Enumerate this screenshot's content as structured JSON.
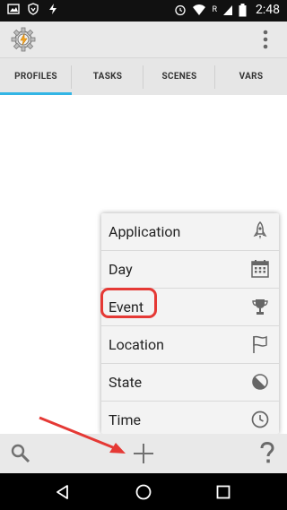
{
  "status_bar": {
    "time": "2:48",
    "network_label": "R",
    "icons": [
      "image-icon",
      "shield-icon",
      "flash-icon",
      "alarm-icon",
      "wifi-icon",
      "signal-icon",
      "battery-icon"
    ]
  },
  "app_bar": {
    "icon": "tasker-gear-icon",
    "overflow_icon": "overflow-menu-icon"
  },
  "tabs": [
    {
      "label": "PROFILES",
      "active": true
    },
    {
      "label": "TASKS",
      "active": false
    },
    {
      "label": "SCENES",
      "active": false
    },
    {
      "label": "VARS",
      "active": false
    }
  ],
  "menu": {
    "items": [
      {
        "label": "Application",
        "icon": "rocket-icon"
      },
      {
        "label": "Day",
        "icon": "calendar-icon"
      },
      {
        "label": "Event",
        "icon": "trophy-icon",
        "highlighted": true
      },
      {
        "label": "Location",
        "icon": "flag-icon"
      },
      {
        "label": "State",
        "icon": "contrast-icon"
      },
      {
        "label": "Time",
        "icon": "clock-icon"
      }
    ],
    "highlight_color": "#e53935"
  },
  "bottom_bar": {
    "search_icon": "search-icon",
    "add_icon": "add-icon",
    "help_icon": "help-icon"
  },
  "nav_bar": {
    "back": "back-icon",
    "home": "home-icon",
    "recents": "recents-icon"
  },
  "colors": {
    "accent": "#33b5e5",
    "annotation_red": "#e53935"
  }
}
